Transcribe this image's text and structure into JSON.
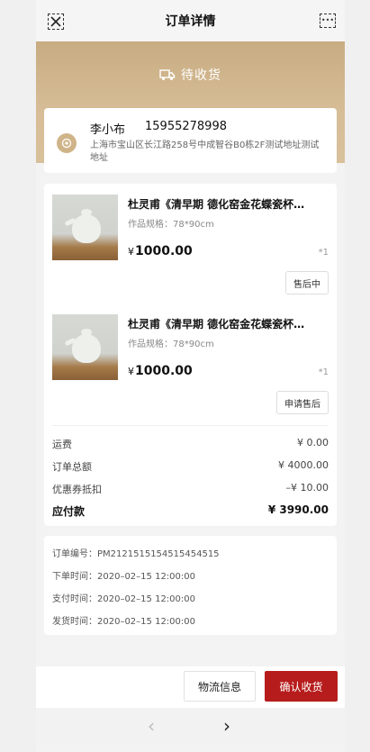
{
  "nav": {
    "title": "订单详情"
  },
  "status": {
    "label": "待收货"
  },
  "address": {
    "name": "李小布",
    "phone": "15955278998",
    "detail": "上海市宝山区长江路258号中成智谷B0栋2F测试地址测试地址"
  },
  "goods": [
    {
      "title": "杜灵甫《清早期 德化窑金花蝶瓷杯…",
      "spec": "作品规格：78*90cm",
      "currency": "¥",
      "price": "1000.00",
      "qty": "*1",
      "action": "售后中"
    },
    {
      "title": "杜灵甫《清早期 德化窑金花蝶瓷杯…",
      "spec": "作品规格：78*90cm",
      "currency": "¥",
      "price": "1000.00",
      "qty": "*1",
      "action": "申请售后"
    }
  ],
  "fees": {
    "shipping": {
      "label": "运费",
      "value": "¥ 0.00"
    },
    "total": {
      "label": "订单总额",
      "value": "¥ 4000.00"
    },
    "coupon": {
      "label": "优惠券抵扣",
      "value": "–¥ 10.00"
    },
    "payable": {
      "label": "应付款",
      "value": "¥ 3990.00"
    }
  },
  "order_info": {
    "number": "订单编号：PM2121515154515454515",
    "created": "下单时间：2020–02–15 12:00:00",
    "paid": "支付时间：2020–02–15 12:00:00",
    "shipped": "发货时间：2020–02–15 12:00:00"
  },
  "actions": {
    "logistics": "物流信息",
    "confirm": "确认收货"
  },
  "colors": {
    "hero": "#c8ac82",
    "accent": "#b71c1c"
  }
}
